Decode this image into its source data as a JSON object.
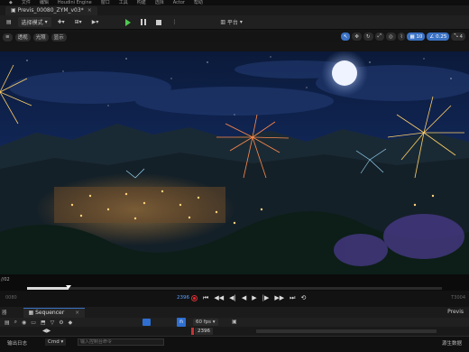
{
  "menu": [
    "文件",
    "编辑",
    "窗口",
    "工具",
    "构建",
    "选择",
    "Actor",
    "帮助"
  ],
  "app_title": "Houdini Engine",
  "tab": {
    "title": "Previs_00080_ZYM_v03*",
    "close": "×"
  },
  "toolbar": {
    "select_mode": "选择模式",
    "platform": "平台",
    "play_icon": "play-icon",
    "pause_icon": "pause-icon",
    "stop_icon": "stop-icon"
  },
  "viewport_toolbar": {
    "left_buttons": [
      "透视",
      "光照",
      "显示"
    ],
    "right_values": [
      "10",
      "0.25",
      "4"
    ]
  },
  "scrubber": {
    "label": "//02",
    "progress": 0.1
  },
  "transport": {
    "start": "0080",
    "end": "T3004",
    "frame": "2396"
  },
  "tabs": {
    "side_label": "器",
    "sequencer_label": "Sequencer",
    "close": "×",
    "right_label": "Previs"
  },
  "seq_toolbar": {
    "fps": "60 fps",
    "n_icon": "n"
  },
  "seq_time": {
    "current": "2396"
  },
  "statusbar": {
    "log_label": "输出日志",
    "cmd_label": "Cmd",
    "cmd_placeholder": "输入控制台命令",
    "source_label": "源生数据"
  },
  "colors": {
    "accent": "#2f6fd0",
    "record": "#e22233",
    "play": "#4fc94f"
  }
}
